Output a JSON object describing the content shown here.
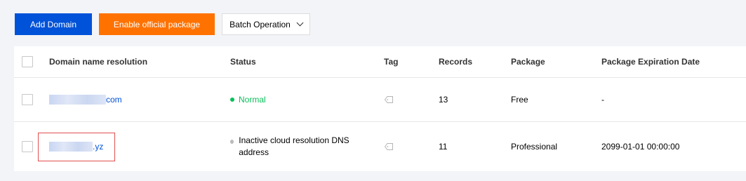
{
  "toolbar": {
    "add_domain": "Add Domain",
    "enable_package": "Enable official package",
    "batch_operation": "Batch Operation",
    "colors": {
      "primary": "#0052d9",
      "orange": "#ff7200"
    }
  },
  "table": {
    "headers": {
      "domain": "Domain name resolution",
      "status": "Status",
      "tag": "Tag",
      "records": "Records",
      "package": "Package",
      "expiration": "Package Expiration Date"
    },
    "rows": [
      {
        "domain_suffix": "com",
        "status": "Normal",
        "tag_icon": "tag-icon",
        "records": "13",
        "package": "Free",
        "expiration": "-"
      },
      {
        "domain_suffix": ".yz",
        "status": "Inactive cloud resolution DNS address",
        "tag_icon": "tag-icon",
        "records": "11",
        "package": "Professional",
        "expiration": "2099-01-01 00:00:00"
      }
    ]
  }
}
